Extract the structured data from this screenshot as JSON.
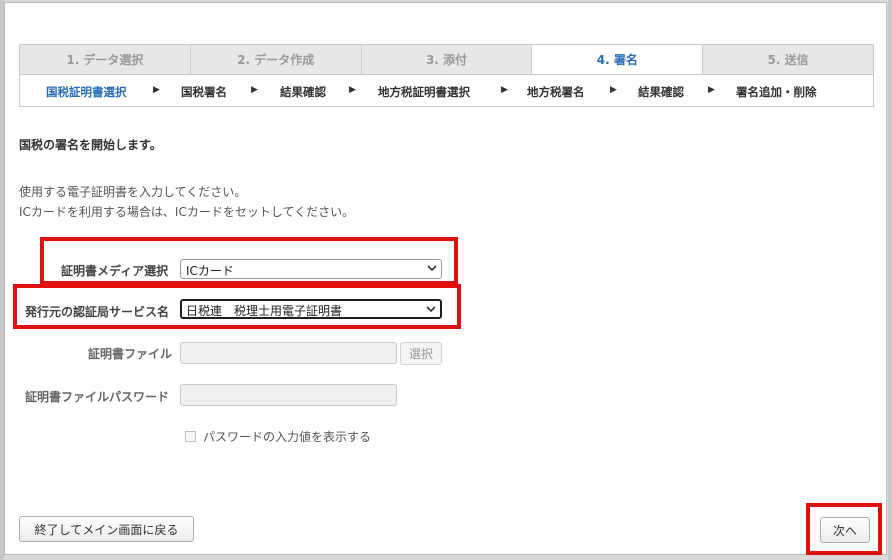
{
  "steps": [
    {
      "label": "1. データ選択",
      "active": false
    },
    {
      "label": "2. データ作成",
      "active": false
    },
    {
      "label": "3. 添付",
      "active": false
    },
    {
      "label": "4. 署名",
      "active": true
    },
    {
      "label": "5. 送信",
      "active": false
    }
  ],
  "substeps": [
    "国税証明書選択",
    "国税署名",
    "結果確認",
    "地方税証明書選択",
    "地方税署名",
    "結果確認",
    "署名追加・削除"
  ],
  "heading": "国税の署名を開始します。",
  "instructions": [
    "使用する電子証明書を入力してください。",
    "ICカードを利用する場合は、ICカードをセットしてください。"
  ],
  "form": {
    "media_label": "証明書メディア選択",
    "media_value": "ICカード",
    "ca_label": "発行元の認証局サービス名",
    "ca_value": "日税連　税理士用電子証明書",
    "file_label": "証明書ファイル",
    "file_button": "選択",
    "password_label": "証明書ファイルパスワード",
    "show_password_label": "パスワードの入力値を表示する"
  },
  "footer": {
    "exit_button": "終了してメイン画面に戻る",
    "next_button": "次へ"
  },
  "colors": {
    "accent": "#2a6ebb",
    "highlight": "#e01010"
  }
}
